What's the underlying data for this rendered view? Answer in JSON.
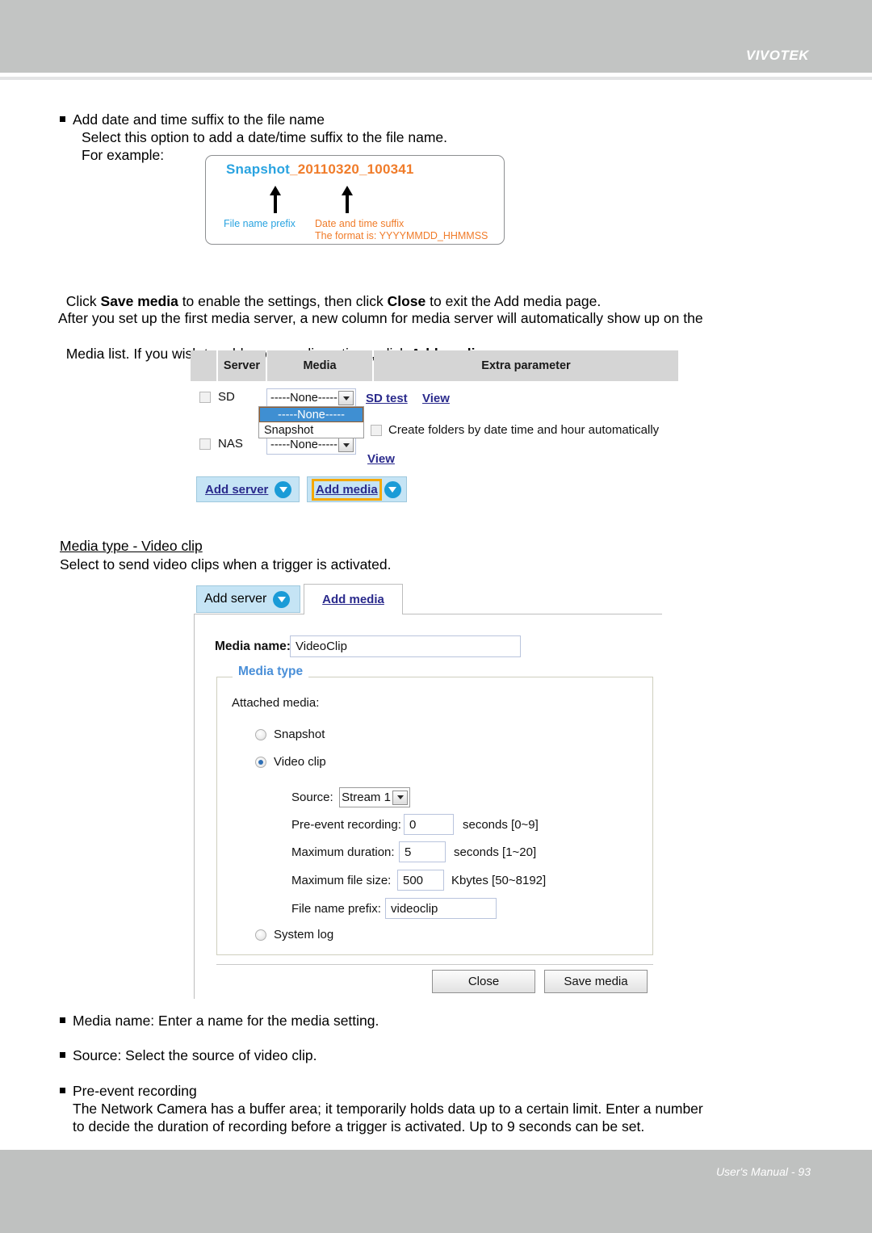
{
  "header": {
    "logo": "VIVOTEK"
  },
  "footer": {
    "text": "User's Manual - 93"
  },
  "section_suffix": {
    "bullet_title": "Add date and time suffix to the file name",
    "line1": "Select this option to add a date/time suffix to the file name.",
    "line2": "For example:",
    "example": {
      "filename_prefix": "Snapshot",
      "filename_suffix": "_20110320_100341",
      "label_prefix": "File name prefix",
      "label_suffix": "Date and time suffix",
      "label_format": "The format is: YYYYMMDD_HHMMSS"
    }
  },
  "paragraphs": {
    "save_media": {
      "a": "Click ",
      "b1": "Save media",
      "c": " to enable the settings, then click ",
      "b2": "Close",
      "d": " to exit the Add media page."
    },
    "media_server": {
      "line1": "After you set up the first media server, a new column for media server will automatically show up on the",
      "line2a": "Media list. If you wish to add more media options, click ",
      "line2b": "Add media",
      "line2c": "."
    }
  },
  "media_table": {
    "columns": [
      "",
      "Server",
      "Media",
      "Extra parameter"
    ],
    "rows": [
      {
        "server": "SD",
        "media_value": "-----None-----",
        "links": [
          "SD test",
          "View"
        ]
      },
      {
        "server": "NAS",
        "media_value": "-----None-----",
        "links": [
          "View"
        ]
      }
    ],
    "dropdown_options": [
      "-----None-----",
      "Snapshot"
    ],
    "extra_checkbox_label": "Create folders by date time and hour automatically",
    "buttons": {
      "add_server": "Add server",
      "add_media": "Add media"
    }
  },
  "section_videoclip": {
    "heading": "Media type - Video clip",
    "subtitle": "Select to send video clips when a trigger is activated."
  },
  "add_media_form": {
    "tabs": {
      "add_server": "Add server",
      "add_media": "Add media"
    },
    "media_name_label": "Media name:",
    "media_name_value": "VideoClip",
    "fieldset_legend": "Media type",
    "attached_media_label": "Attached media:",
    "options": [
      {
        "label": "Snapshot",
        "checked": false
      },
      {
        "label": "Video clip",
        "checked": true
      },
      {
        "label": "System log",
        "checked": false
      }
    ],
    "source_label": "Source:",
    "source_value": "Stream 1",
    "preevent_label": "Pre-event recording:",
    "preevent_value": "0",
    "preevent_unit": "seconds [0~9]",
    "maxduration_label": "Maximum duration:",
    "maxduration_value": "5",
    "maxduration_unit": "seconds [1~20]",
    "maxfilesize_label": "Maximum file size:",
    "maxfilesize_value": "500",
    "maxfilesize_unit": "Kbytes [50~8192]",
    "fileprefix_label": "File name prefix:",
    "fileprefix_value": "videoclip",
    "close_button": "Close",
    "save_button": "Save media"
  },
  "bullets": {
    "media_name": "Media name: Enter a name for the media setting.",
    "source": "Source: Select the source of video clip.",
    "preevent_title": "Pre-event recording",
    "preevent_line1": "The Network Camera has a buffer area; it temporarily holds data up to a certain limit. Enter a number",
    "preevent_line2": "to decide the duration of recording before a trigger is activated. Up to 9 seconds can be set."
  }
}
